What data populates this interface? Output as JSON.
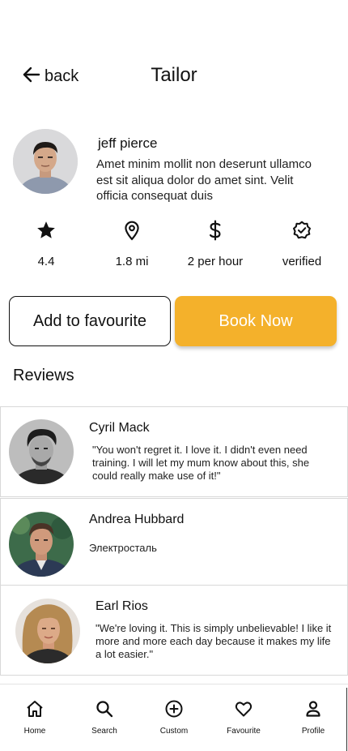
{
  "header": {
    "back_label": "back",
    "title": "Tailor"
  },
  "profile": {
    "name": "jeff pierce",
    "bio": "Amet minim mollit non deserunt ullamco est sit aliqua dolor do amet sint. Velit officia consequat duis"
  },
  "stats": [
    {
      "icon": "star-icon",
      "label": "4.4"
    },
    {
      "icon": "location-pin-icon",
      "label": "1.8 mi"
    },
    {
      "icon": "dollar-icon",
      "label": "2 per hour"
    },
    {
      "icon": "verified-badge-icon",
      "label": "verified"
    }
  ],
  "actions": {
    "favourite_label": "Add to favourite",
    "book_label": "Book Now"
  },
  "colors": {
    "accent": "#f4b12b",
    "text": "#111111",
    "border": "#d8d8d8"
  },
  "reviews": {
    "heading": "Reviews",
    "items": [
      {
        "name": "Cyril Mack",
        "text": "\"You won't regret it. I love it. I didn't even need training. I will let my mum know about this, she could really make use of it!\""
      },
      {
        "name": "Andrea Hubbard",
        "text": "Электросталь"
      },
      {
        "name": "Earl Rios",
        "text": "\"We're loving it. This is simply unbelievable! I like it more and more each day because it makes my life a lot easier.\""
      }
    ]
  },
  "nav": {
    "items": [
      {
        "icon": "home-icon",
        "label": "Home"
      },
      {
        "icon": "search-icon",
        "label": "Search"
      },
      {
        "icon": "add-circle-icon",
        "label": "Custom"
      },
      {
        "icon": "heart-icon",
        "label": "Favourite"
      },
      {
        "icon": "person-icon",
        "label": "Profile"
      }
    ]
  }
}
